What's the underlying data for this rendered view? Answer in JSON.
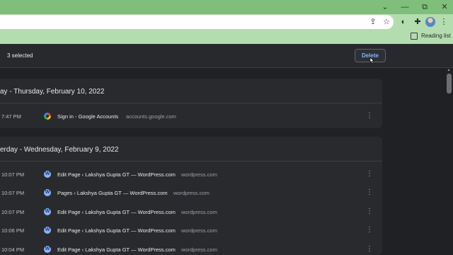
{
  "window": {
    "controls": {
      "chevron": "⌄",
      "minimize": "—",
      "maximize": "⧉",
      "close": "✕"
    }
  },
  "toolbar": {
    "icons": [
      "share-icon",
      "star-icon",
      "extension-icon",
      "puzzle-icon",
      "profile-avatar",
      "menu-icon"
    ],
    "glyphs": {
      "share": "⇪",
      "star": "☆",
      "ext": "◐",
      "puzzle": "✚",
      "menu": "⋮"
    }
  },
  "bookmarks": {
    "reading_list_label": "Reading list"
  },
  "selection": {
    "count_label": "3 selected",
    "delete_label": "Delete"
  },
  "history": {
    "groups": [
      {
        "heading": "ay - Thursday, February 10, 2022",
        "entries": [
          {
            "time": "7:47 PM",
            "favicon": "google-icon",
            "title": "Sign in - Google Accounts",
            "domain": "accounts.google.com"
          }
        ]
      },
      {
        "heading": "erday - Wednesday, February 9, 2022",
        "entries": [
          {
            "time": "10:07 PM",
            "favicon": "wordpress-icon",
            "title": "Edit Page ‹ Lakshya Gupta GT — WordPress.com",
            "domain": "wordpress.com"
          },
          {
            "time": "10:07 PM",
            "favicon": "wordpress-icon",
            "title": "Pages ‹ Lakshya Gupta GT — WordPress.com",
            "domain": "wordpress.com"
          },
          {
            "time": "10:07 PM",
            "favicon": "wordpress-icon",
            "title": "Edit Page ‹ Lakshya Gupta GT — WordPress.com",
            "domain": "wordpress.com"
          },
          {
            "time": "10:06 PM",
            "favicon": "wordpress-icon",
            "title": "Edit Page ‹ Lakshya Gupta GT — WordPress.com",
            "domain": "wordpress.com"
          },
          {
            "time": "10:04 PM",
            "favicon": "wordpress-icon",
            "title": "Edit Page ‹ Lakshya Gupta GT — WordPress.com",
            "domain": "wordpress.com"
          }
        ]
      }
    ]
  },
  "colors": {
    "titlebar": "#7fbe7b",
    "toolbar": "#b3dcaf",
    "background": "#202124",
    "card": "#292a2d",
    "accent": "#8ab4f8",
    "text": "#e8eaed",
    "muted": "#9aa0a6"
  }
}
